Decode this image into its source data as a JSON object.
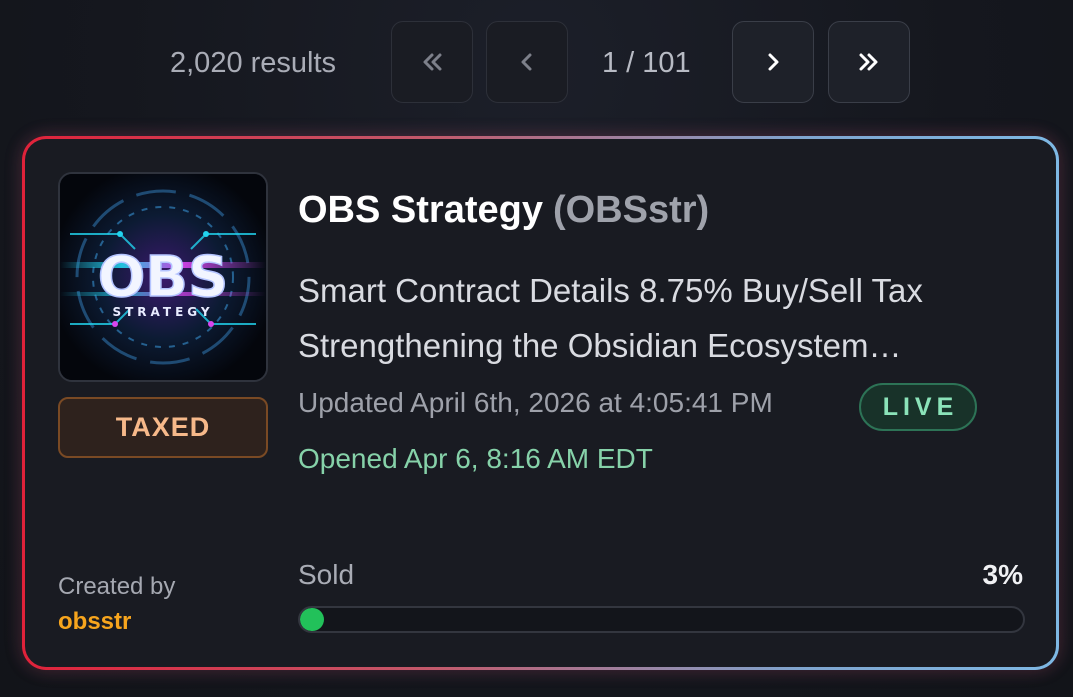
{
  "pagination": {
    "results_text": "2,020 results",
    "page_text": "1 / 101",
    "first_icon": "double-chevron-left-icon",
    "prev_icon": "chevron-left-icon",
    "next_icon": "chevron-right-icon",
    "last_icon": "double-chevron-right-icon"
  },
  "token": {
    "name": "OBS Strategy",
    "ticker": "(OBSstr)",
    "logo_text": "OBS",
    "logo_subtext": "STRATEGY",
    "badge": "TAXED",
    "description_line1": "Smart Contract Details 8.75% Buy/Sell Tax",
    "description_line2": "Strengthening the Obsidian Ecosystem…",
    "updated": "Updated April 6th, 2026 at 4:05:41 PM",
    "status": "LIVE",
    "opened": "Opened Apr 6, 8:16 AM EDT",
    "created_by_label": "Created by",
    "creator": "obsstr",
    "sold_label": "Sold",
    "sold_percent_text": "3%",
    "sold_fraction": 0.03
  },
  "colors": {
    "border_left": "#e0223a",
    "border_right": "#7eb8e4",
    "live": "#8be3b9",
    "opened": "#86d2a9",
    "creator": "#f7a51d",
    "progress": "#22c15a",
    "badge_text": "#f6b98a"
  }
}
